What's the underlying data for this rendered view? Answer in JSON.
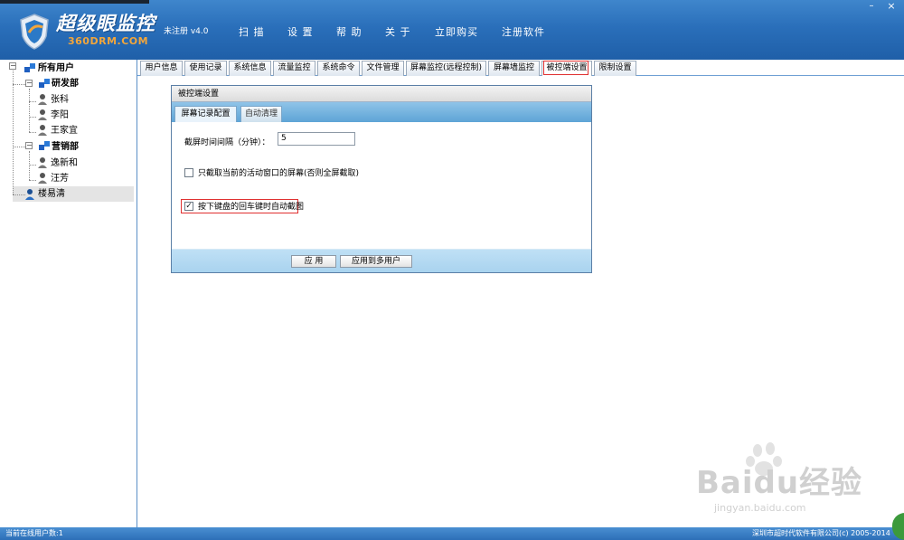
{
  "header": {
    "app_title": "超级眼监控",
    "app_subtitle": "360DRM.COM",
    "registration": "未注册 v4.0",
    "menu": [
      "扫 描",
      "设 置",
      "帮 助",
      "关 于",
      "立即购买",
      "注册软件"
    ],
    "minimize": "–",
    "close": "×"
  },
  "tree": {
    "root": "所有用户",
    "groups": [
      {
        "name": "研发部",
        "users": [
          "张科",
          "李阳",
          "王家宜"
        ]
      },
      {
        "name": "营销部",
        "users": [
          "逸新和",
          "汪芳"
        ]
      }
    ],
    "standalone": "楼易清"
  },
  "tabs": [
    "用户信息",
    "使用记录",
    "系统信息",
    "流量监控",
    "系统命令",
    "文件管理",
    "屏幕监控(远程控制)",
    "屏幕墙监控",
    "被控端设置",
    "限制设置"
  ],
  "active_tab": "被控端设置",
  "dialog": {
    "title": "被控端设置",
    "tabs": [
      "屏幕记录配置",
      "自动清理"
    ],
    "interval_label": "截屏时间间隔（分钟）：",
    "interval_value": "5",
    "option1": "只截取当前的活动窗口的屏幕(否则全屏截取)",
    "option1_checked": "",
    "option2": "按下键盘的回车键时自动截图",
    "option2_checked": "✓",
    "apply": "应 用",
    "apply_multi": "应用到多用户"
  },
  "status": {
    "online": "当前在线用户数:1",
    "copyright": "深圳市超时代软件有限公司(c) 2005-2014"
  },
  "watermark": {
    "brand": "Baidu经验",
    "url": "jingyan.baidu.com"
  },
  "colors": {
    "header_blue": "#2a6fba",
    "accent_orange": "#f3a63b",
    "highlight_red": "#e03030"
  }
}
